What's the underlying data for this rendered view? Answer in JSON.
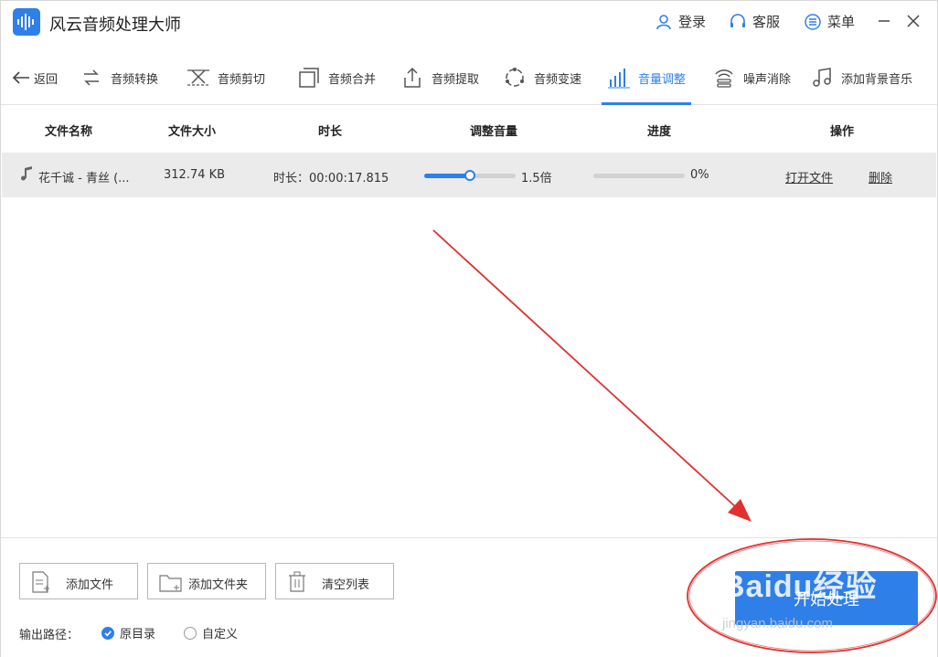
{
  "app": {
    "title": "风云音频处理大师",
    "accent": "#2f7fe9"
  },
  "titlebar": {
    "login_label": "登录",
    "service_label": "客服",
    "menu_label": "菜单"
  },
  "toolbar": {
    "back_label": "返回",
    "tools": [
      {
        "label": "音频转换",
        "icon": "convert-icon"
      },
      {
        "label": "音频剪切",
        "icon": "scissors-icon"
      },
      {
        "label": "音频合并",
        "icon": "merge-icon"
      },
      {
        "label": "音频提取",
        "icon": "extract-icon"
      },
      {
        "label": "音频变速",
        "icon": "speed-icon"
      },
      {
        "label": "音量调整",
        "icon": "volume-bars-icon",
        "active": true
      },
      {
        "label": "噪声消除",
        "icon": "noise-icon"
      },
      {
        "label": "添加背景音乐",
        "icon": "music-note-icon"
      }
    ]
  },
  "table": {
    "columns": [
      "文件名称",
      "文件大小",
      "时长",
      "调整音量",
      "进度",
      "操作"
    ],
    "rows": [
      {
        "name": "花千诚 - 青丝 (...",
        "size": "312.74 KB",
        "duration": "时长：00:00:17.815",
        "volume_label": "1.5倍",
        "volume_fraction": 0.5,
        "progress_label": "0%",
        "progress_fraction": 0,
        "open_label": "打开文件",
        "delete_label": "删除"
      }
    ]
  },
  "bottom": {
    "add_file_label": "添加文件",
    "add_folder_label": "添加文件夹",
    "clear_list_label": "清空列表",
    "output_label": "输出路径：",
    "option_original": "原目录",
    "option_custom": "自定义",
    "start_label": "开始处理"
  },
  "overlay": {
    "watermark": "Baidu经验",
    "watermark_sub": "jingyan.baidu.com",
    "annotation_color": "#e03030"
  }
}
